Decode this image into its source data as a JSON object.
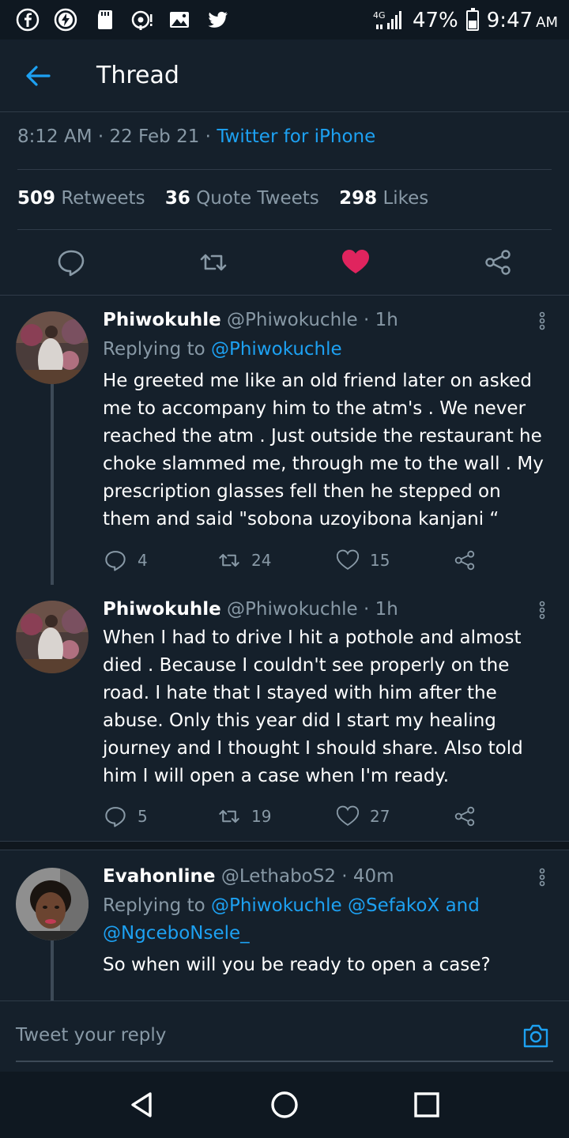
{
  "status_bar": {
    "left_icons": [
      "facebook-icon",
      "messenger-lightning-icon",
      "sd-card-icon",
      "hotspot-icon",
      "gallery-icon",
      "twitter-bird-icon"
    ],
    "network": "4G",
    "battery": "47%",
    "time": "9:47",
    "ampm": "AM"
  },
  "header": {
    "title": "Thread"
  },
  "tweet_meta": {
    "time": "8:12 AM",
    "date": "22 Feb 21",
    "source": "Twitter for iPhone"
  },
  "stats": {
    "retweets_count": "509",
    "retweets_label": "Retweets",
    "quotes_count": "36",
    "quotes_label": "Quote Tweets",
    "likes_count": "298",
    "likes_label": "Likes"
  },
  "replies": [
    {
      "name": "Phiwokuhle",
      "handle": "@Phiwokuchle",
      "time": "1h",
      "replying_label": "Replying to",
      "replying_to": "@Phiwokuchle",
      "text": "He greeted me like an old friend later on asked me to accompany him to the atm's . We never reached the atm . Just outside the restaurant he choke slammed me, through me to the wall . My prescription glasses fell then he stepped on them and said \"sobona uzoyibona kanjani “",
      "replies": "4",
      "retweets": "24",
      "likes": "15"
    },
    {
      "name": "Phiwokuhle",
      "handle": "@Phiwokuchle",
      "time": "1h",
      "text": "When I had to drive I hit a pothole and almost died . Because I couldn't see properly on the road. I hate that I stayed with him after the abuse. Only this year did I start my healing journey and I thought I should share. Also told him I will open a case when I'm ready.",
      "replies": "5",
      "retweets": "19",
      "likes": "27"
    },
    {
      "name": "Evahonline",
      "handle": "@LethaboS2",
      "time": "40m",
      "replying_label": "Replying to",
      "replying_to": "@Phiwokuchle @SefakoX",
      "replying_and": "and",
      "replying_to_2": "@NgceboNsele_",
      "text": "So when will you be ready to open a case?"
    }
  ],
  "reply_box": {
    "placeholder": "Tweet your reply"
  },
  "colors": {
    "background": "#15202b",
    "accent": "#1da1f2",
    "like": "#e0245e",
    "muted": "#8899a6"
  }
}
